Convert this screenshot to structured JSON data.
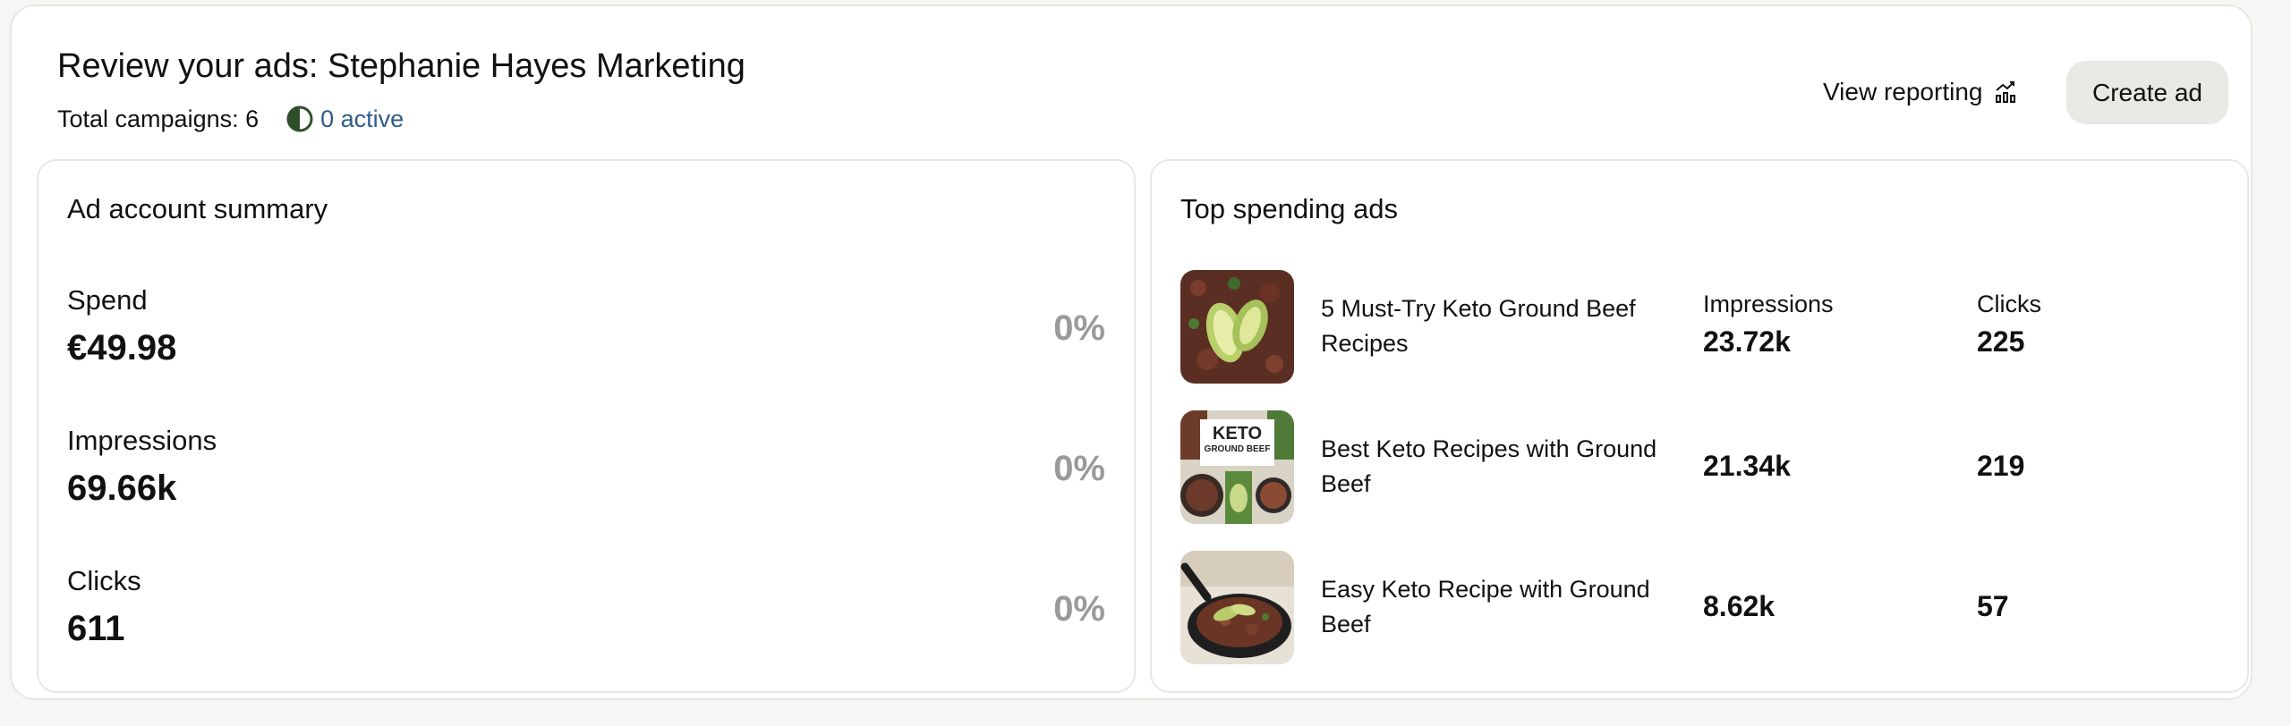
{
  "header": {
    "title": "Review your ads: Stephanie Hayes Marketing",
    "total_campaigns": "Total campaigns: 6",
    "active": "0 active",
    "view_reporting": "View reporting",
    "create_ad": "Create ad"
  },
  "summary": {
    "title": "Ad account summary",
    "metrics": [
      {
        "label": "Spend",
        "value": "€49.98",
        "change": "0%"
      },
      {
        "label": "Impressions",
        "value": "69.66k",
        "change": "0%"
      },
      {
        "label": "Clicks",
        "value": "611",
        "change": "0%"
      }
    ]
  },
  "top_ads": {
    "title": "Top spending ads",
    "columns": {
      "impressions": "Impressions",
      "clicks": "Clicks"
    },
    "thumb_text": {
      "line1": "KETO",
      "line2": "GROUND BEEF"
    },
    "ads": [
      {
        "name": "5 Must-Try Keto Ground Beef Recipes",
        "impressions": "23.72k",
        "clicks": "225"
      },
      {
        "name": "Best Keto Recipes with Ground Beef",
        "impressions": "21.34k",
        "clicks": "219"
      },
      {
        "name": "Easy Keto Recipe with Ground Beef",
        "impressions": "8.62k",
        "clicks": "57"
      }
    ]
  },
  "colors": {
    "accent_link": "#2f5b8a",
    "status_icon": "#2f4f2a",
    "button_bg": "#e9e8e4",
    "muted": "#9a9a9a"
  },
  "icons": {
    "status": "half-circle-icon",
    "reporting": "chart-icon"
  }
}
